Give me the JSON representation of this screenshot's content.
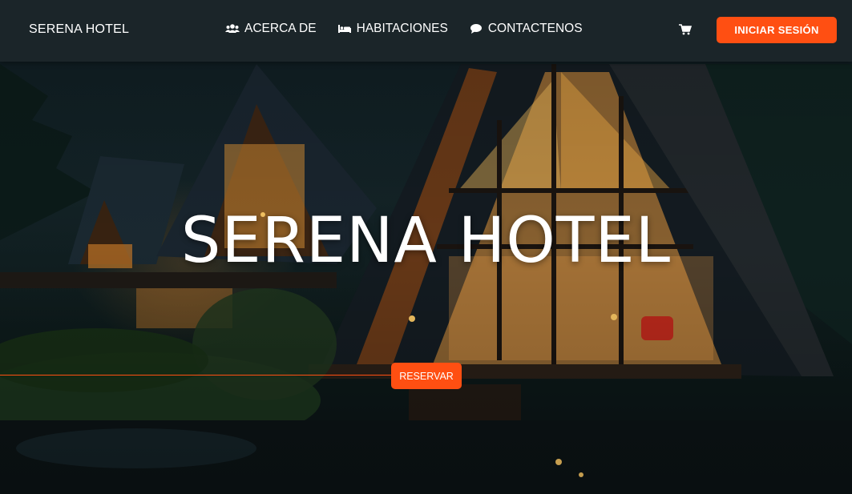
{
  "navbar": {
    "brand": "SERENA HOTEL",
    "links": [
      {
        "label": "ACERCA DE",
        "icon": "users-icon"
      },
      {
        "label": "HABITACIONES",
        "icon": "bed-icon"
      },
      {
        "label": "CONTACTENOS",
        "icon": "chat-icon"
      }
    ],
    "cart_icon": "shopping-cart-icon",
    "login_label": "INICIAR SESIÓN"
  },
  "hero": {
    "title": "SERENA HOTEL",
    "reserve_label": "RESERVAR",
    "background_image": "a-frame-cabins-night-forest"
  },
  "colors": {
    "accent": "#ff4f12",
    "navbar_bg": "#1c262a",
    "text": "#ffffff"
  }
}
